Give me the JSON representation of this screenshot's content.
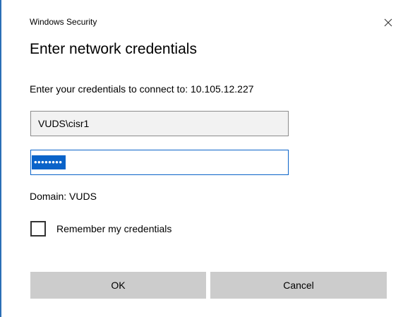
{
  "window": {
    "title": "Windows Security",
    "close_icon": "close-icon"
  },
  "dialog": {
    "heading": "Enter network credentials",
    "description": "Enter your credentials to connect to: 10.105.12.227"
  },
  "form": {
    "username_value": "VUDS\\cisr1",
    "password_mask": "••••••••",
    "password_selected": true,
    "domain_text": "Domain: VUDS",
    "remember_label": "Remember my credentials",
    "remember_checked": false
  },
  "buttons": {
    "ok_label": "OK",
    "cancel_label": "Cancel"
  },
  "colors": {
    "accent": "#0a63c9",
    "button_bg": "#cccccc",
    "input_disabled_bg": "#f2f2f2"
  }
}
